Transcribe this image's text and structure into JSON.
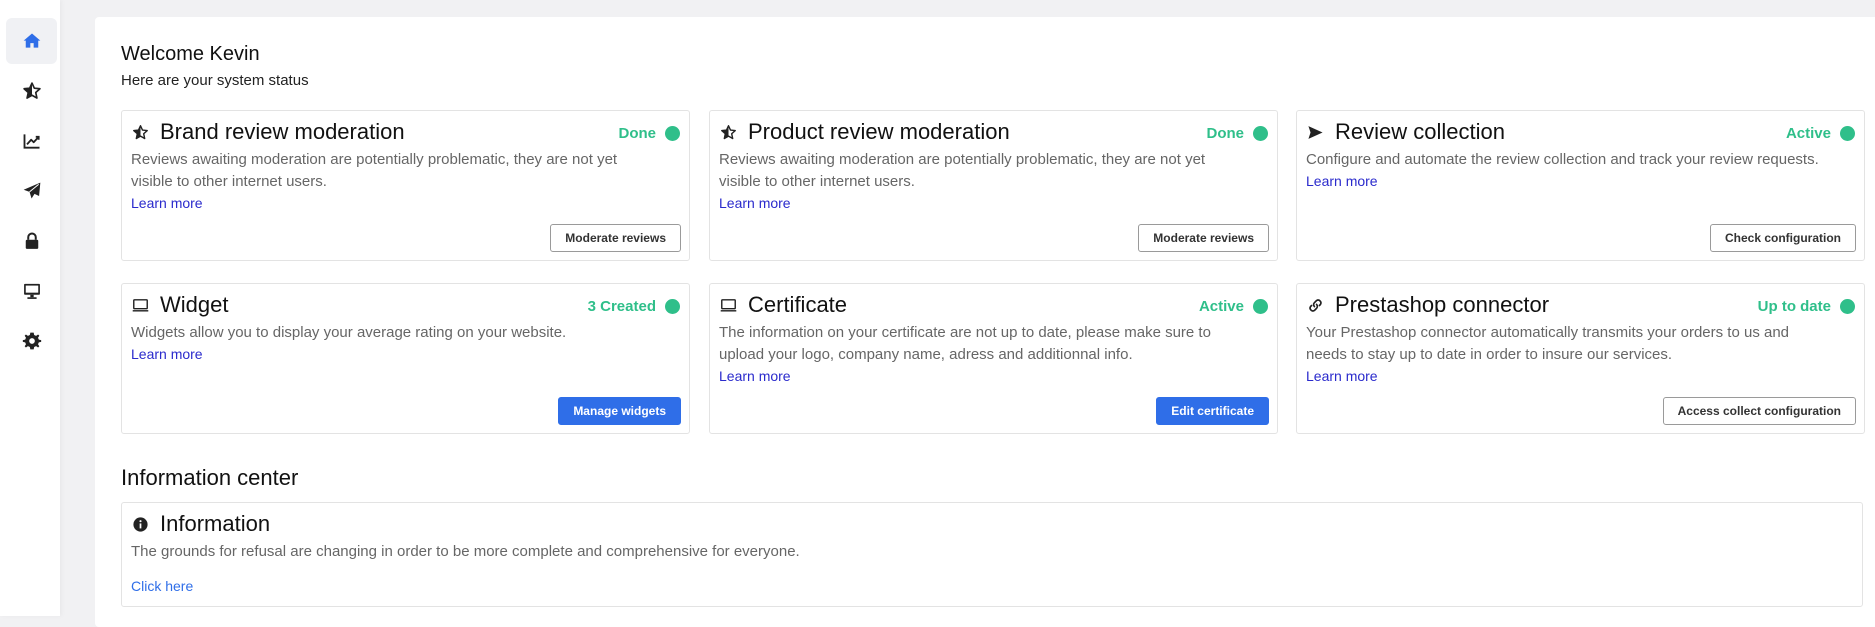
{
  "colors": {
    "accent": "#2f6ee8",
    "status_green": "#2fbf8a",
    "link": "#2a2acc",
    "sidebar_active_icon": "#2f6ee8"
  },
  "sidebar": {
    "items": [
      {
        "icon": "home-icon",
        "active": true
      },
      {
        "icon": "star-icon",
        "active": false
      },
      {
        "icon": "chart-line-icon",
        "active": false
      },
      {
        "icon": "paper-plane-icon",
        "active": false
      },
      {
        "icon": "lock-icon",
        "active": false
      },
      {
        "icon": "desktop-icon",
        "active": false
      },
      {
        "icon": "gear-icon",
        "active": false
      }
    ]
  },
  "welcome": {
    "title": "Welcome Kevin",
    "subtitle": "Here are your system status"
  },
  "cards": [
    {
      "icon": "star-icon",
      "title": "Brand review moderation",
      "status": "Done",
      "description": "Reviews awaiting moderation are potentially problematic, they are not yet visible to other internet users.",
      "link": "Learn more",
      "button": "Moderate reviews",
      "button_style": "outline"
    },
    {
      "icon": "star-icon",
      "title": "Product review moderation",
      "status": "Done",
      "description": "Reviews awaiting moderation are potentially problematic, they are not yet visible to other internet users.",
      "link": "Learn more",
      "button": "Moderate reviews",
      "button_style": "outline"
    },
    {
      "icon": "paper-plane-icon",
      "title": "Review collection",
      "status": "Active",
      "description": "Configure and automate the review collection and track your review requests.",
      "link": "Learn more",
      "button": "Check configuration",
      "button_style": "outline"
    },
    {
      "icon": "desktop-icon",
      "title": "Widget",
      "status": "3 Created",
      "description": "Widgets allow you to display your average rating on your website.",
      "link": "Learn more",
      "button": "Manage widgets",
      "button_style": "primary"
    },
    {
      "icon": "desktop-icon",
      "title": "Certificate",
      "status": "Active",
      "description": "The information on your certificate are not up to date, please make sure to upload your logo, company name, adress and additionnal info.",
      "link": "Learn more",
      "button": "Edit certificate",
      "button_style": "primary"
    },
    {
      "icon": "link-icon",
      "title": "Prestashop connector",
      "status": "Up to date",
      "description": "Your Prestashop connector automatically transmits your orders to us and needs to stay up to date in order to insure our services.",
      "link": "Learn more",
      "button": "Access collect configuration",
      "button_style": "outline"
    }
  ],
  "information_center": {
    "title": "Information center",
    "card": {
      "icon": "info-circle-icon",
      "title": "Information",
      "description": "The grounds for refusal are changing in order to be more complete and comprehensive for everyone.",
      "link": "Click here"
    }
  }
}
